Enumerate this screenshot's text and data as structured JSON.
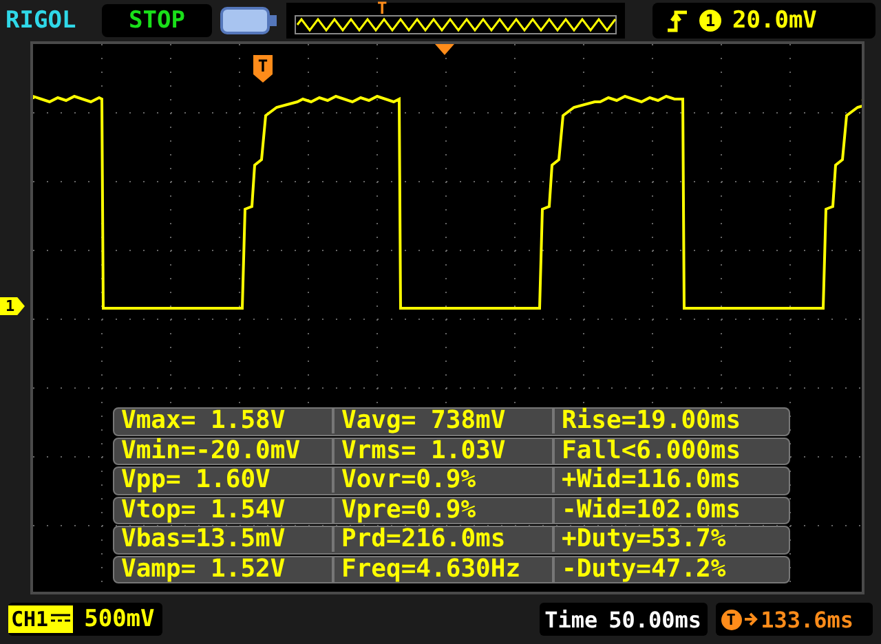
{
  "header": {
    "brand": "RIGOL",
    "run_state": "STOP",
    "memory_marker": "T",
    "trigger": {
      "channel": "1",
      "level": "20.0mV"
    }
  },
  "screen": {
    "trigger_marker": "T",
    "channel_marker": "1"
  },
  "measurements": [
    [
      "Vmax= 1.58V",
      "Vavg= 738mV",
      "Rise=19.00ms"
    ],
    [
      "Vmin=-20.0mV",
      "Vrms= 1.03V",
      "Fall<6.000ms"
    ],
    [
      "Vpp= 1.60V",
      "Vovr=0.9%",
      "+Wid=116.0ms"
    ],
    [
      "Vtop= 1.54V",
      "Vpre=0.9%",
      "-Wid=102.0ms"
    ],
    [
      "Vbas=13.5mV",
      "Prd=216.0ms",
      "+Duty=53.7%"
    ],
    [
      "Vamp= 1.52V",
      "Freq=4.630Hz",
      "-Duty=47.2%"
    ]
  ],
  "footer": {
    "channel": "CH1",
    "scale": "500mV",
    "time_label": "Time",
    "timebase": "50.00ms",
    "trigger_offset_marker": "T",
    "trigger_offset": "133.6ms"
  }
}
